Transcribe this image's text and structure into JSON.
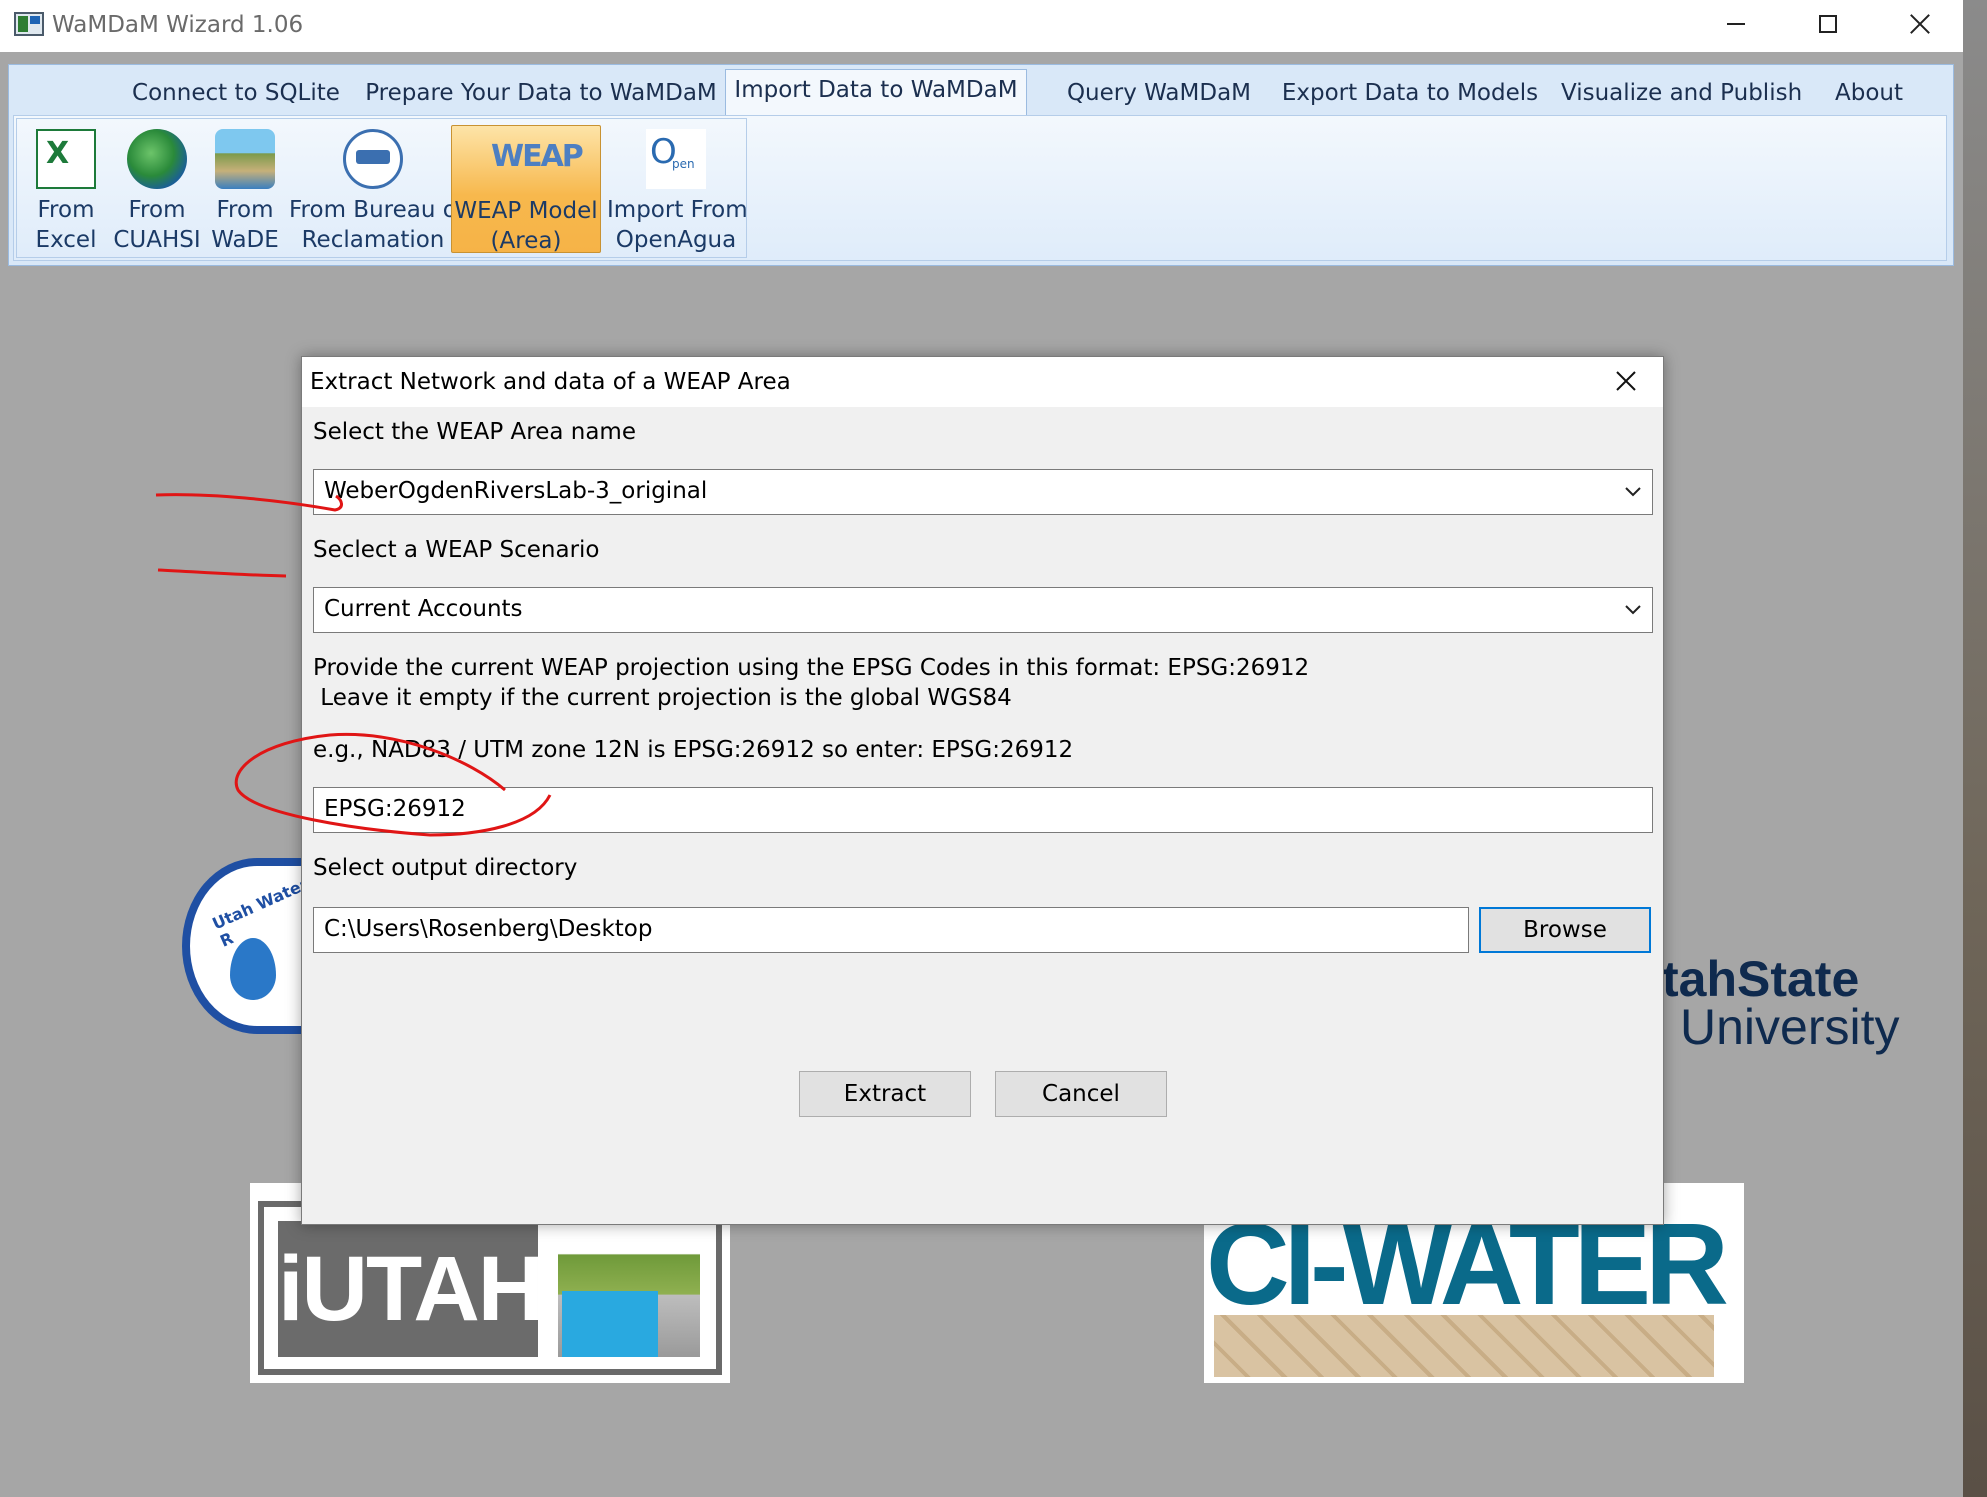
{
  "window": {
    "title": "WaMDaM Wizard 1.06"
  },
  "ribbon": {
    "tabs": [
      {
        "label": "Connect to SQLite"
      },
      {
        "label": "Prepare Your Data to WaMDaM"
      },
      {
        "label": "Import Data to WaMDaM",
        "active": true
      },
      {
        "label": "Query WaMDaM"
      },
      {
        "label": "Export Data to Models"
      },
      {
        "label": "Visualize and Publish"
      },
      {
        "label": "About"
      }
    ],
    "buttons": [
      {
        "line1": "From",
        "line2": "Excel",
        "icon": "excel-icon"
      },
      {
        "line1": "From",
        "line2": "CUAHSI",
        "icon": "cuahsi-icon"
      },
      {
        "line1": "From",
        "line2": "WaDE",
        "icon": "wade-icon"
      },
      {
        "line1": "From Bureau of",
        "line2": "Reclamation",
        "icon": "bureau-of-reclamation-icon"
      },
      {
        "line1": "WEAP Model",
        "line2": "(Area)",
        "icon": "weap-icon",
        "selected": true
      },
      {
        "line1": "Import From",
        "line2": "OpenAgua",
        "icon": "openagua-icon"
      }
    ]
  },
  "background_logos": {
    "usu_line1": "tahState",
    "usu_line2": "University",
    "iutah": "iUTAH",
    "ciwater": "CI-WATER",
    "uwrl_fragment": "Utah Water R"
  },
  "dialog": {
    "title": "Extract Network and data of a WEAP Area",
    "area_label": "Select the WEAP Area name",
    "area_value": "WeberOgdenRiversLab-3_original",
    "scenario_label": "Seclect a WEAP Scenario",
    "scenario_value": "Current Accounts",
    "projection_help_line1": "Provide the current WEAP projection using the EPSG Codes in this format: EPSG:26912",
    "projection_help_line2": " Leave it empty if the current projection is the global WGS84",
    "projection_example": "e.g., NAD83 / UTM zone 12N is EPSG:26912 so enter: EPSG:26912",
    "projection_value": "EPSG:26912",
    "output_label": "Select output directory",
    "output_value": "C:\\Users\\Rosenberg\\Desktop",
    "browse_label": "Browse",
    "extract_label": "Extract",
    "cancel_label": "Cancel"
  },
  "colors": {
    "annotation": "#e01515",
    "ribbon_bg": "#d9e8f8",
    "selected_button": "#f7b84d",
    "default_button_border": "#0078d7"
  }
}
